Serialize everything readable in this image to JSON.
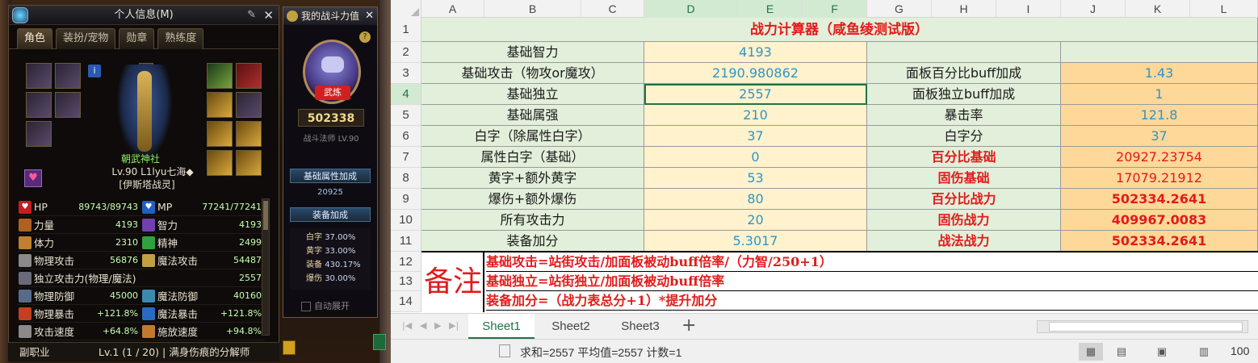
{
  "game": {
    "info_window": {
      "title": "个人信息(M)",
      "tabs": [
        "角色",
        "装扮/宠物",
        "勋章",
        "熟练度"
      ],
      "character": {
        "name": "朝武神社",
        "level_line": "Lv.90 L1lyu七海◆",
        "guild": "[伊斯塔战灵]"
      },
      "stats": [
        {
          "left": {
            "label": "HP",
            "value": "89743/89743",
            "icon": "heart-red-icon"
          },
          "right": {
            "label": "MP",
            "value": "77241/77241",
            "icon": "heart-blue-icon"
          }
        },
        {
          "left": {
            "label": "力量",
            "value": "4193",
            "icon": "strength-icon"
          },
          "right": {
            "label": "智力",
            "value": "4193",
            "icon": "intelligence-icon"
          }
        },
        {
          "left": {
            "label": "体力",
            "value": "2310",
            "icon": "vitality-icon"
          },
          "right": {
            "label": "精神",
            "value": "2499",
            "icon": "spirit-icon"
          }
        },
        {
          "left": {
            "label": "物理攻击",
            "value": "56876",
            "icon": "sword-icon"
          },
          "right": {
            "label": "魔法攻击",
            "value": "54487",
            "icon": "magic-icon"
          }
        },
        {
          "full": {
            "label": "独立攻击力(物理/魔法)",
            "value": "2557",
            "icon": "independent-attack-icon"
          }
        },
        {
          "left": {
            "label": "物理防御",
            "value": "45000",
            "icon": "shield-icon"
          },
          "right": {
            "label": "魔法防御",
            "value": "40160",
            "icon": "magic-shield-icon"
          }
        },
        {
          "left": {
            "label": "物理暴击",
            "value": "+121.8%",
            "icon": "crit-icon"
          },
          "right": {
            "label": "魔法暴击",
            "value": "+121.8%",
            "icon": "magic-crit-icon"
          }
        },
        {
          "left": {
            "label": "攻击速度",
            "value": "+64.8%",
            "icon": "attack-speed-icon"
          },
          "right": {
            "label": "施放速度",
            "value": "+94.8%",
            "icon": "cast-speed-icon"
          }
        }
      ],
      "subjob": {
        "label": "副职业",
        "level": "Lv.1 (1 / 20) | 满身伤痕的分解师"
      }
    },
    "power_window": {
      "title": "我的战斗力值",
      "emblem_label": "武炼",
      "score": "502338",
      "job": "战斗法师 LV.90",
      "base_section": "基础属性加成",
      "base_value": "20925",
      "equip_section": "装备加成",
      "bonuses": [
        {
          "k": "白字",
          "v": "37.00%"
        },
        {
          "k": "黄字",
          "v": "33.00%"
        },
        {
          "k": "装备",
          "v": "430.17%"
        },
        {
          "k": "爆伤",
          "v": "30.00%"
        }
      ],
      "auto_expand": "自动展开"
    }
  },
  "excel": {
    "columns": [
      "A",
      "B",
      "C",
      "D",
      "E",
      "F",
      "G",
      "H",
      "I",
      "J",
      "K",
      "L"
    ],
    "rows": [
      "1",
      "2",
      "3",
      "4",
      "5",
      "6",
      "7",
      "8",
      "9",
      "10",
      "11",
      "12",
      "13",
      "14"
    ],
    "title": "战力计算器（咸鱼绫测试版）",
    "left_table": [
      {
        "label": "基础智力",
        "value": "4193"
      },
      {
        "label": "基础攻击（物攻or魔攻）",
        "value": "2190.980862"
      },
      {
        "label": "基础独立",
        "value": "2557"
      },
      {
        "label": "基础属强",
        "value": "210"
      },
      {
        "label": "白字（除属性白字）",
        "value": "37"
      },
      {
        "label": "属性白字（基础）",
        "value": "0"
      },
      {
        "label": "黄字+额外黄字",
        "value": "53"
      },
      {
        "label": "爆伤+额外爆伤",
        "value": "80"
      },
      {
        "label": "所有攻击力",
        "value": "20"
      },
      {
        "label": "装备加分",
        "value": "5.3017"
      }
    ],
    "right_table": [
      {
        "label": "",
        "value": ""
      },
      {
        "label": "面板百分比buff加成",
        "value": "1.43"
      },
      {
        "label": "面板独立buff加成",
        "value": "1"
      },
      {
        "label": "暴击率",
        "value": "121.8"
      },
      {
        "label": "白字分",
        "value": "37"
      },
      {
        "label": "百分比基础",
        "value": "20927.23754"
      },
      {
        "label": "固伤基础",
        "value": "17079.21912"
      },
      {
        "label": "百分比战力",
        "value": "502334.2641"
      },
      {
        "label": "固伤战力",
        "value": "409967.0083"
      },
      {
        "label": "战法战力",
        "value": "502334.2641"
      }
    ],
    "notes_label": "备注",
    "notes": [
      "基础攻击=站街攻击/加面板被动buff倍率/（力智/250+1）",
      "基础独立=站街独立/加面板被动buff倍率",
      "装备加分=（战力表总分+1）*提升加分"
    ],
    "sheets": [
      "Sheet1",
      "Sheet2",
      "Sheet3"
    ],
    "status": "求和=2557 平均值=2557 计数=1",
    "zoom": "100"
  }
}
